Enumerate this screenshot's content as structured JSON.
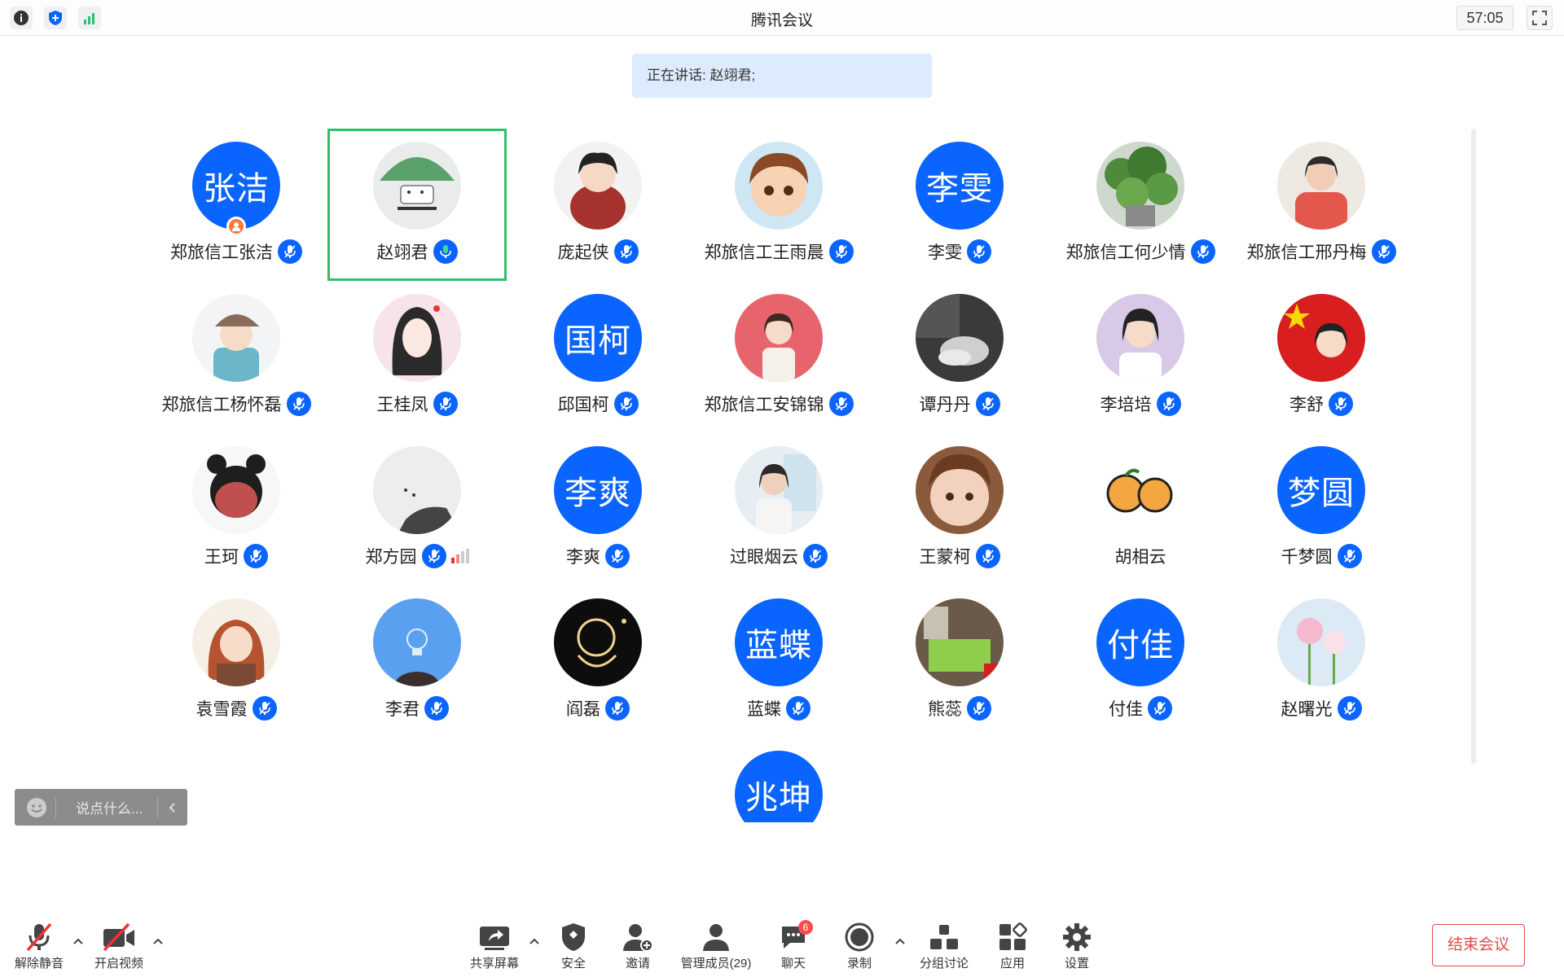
{
  "window": {
    "title": "腾讯会议",
    "timer": "57:05"
  },
  "speaking_banner": "正在讲话: 赵翊君;",
  "colors": {
    "accent": "#0a64ff",
    "active_border": "#2fbf6b",
    "end_red": "#e14b4b",
    "banner_bg": "#dcebfd"
  },
  "participants": [
    {
      "name": "郑旅信工张洁",
      "initials": "张洁",
      "host": true
    },
    {
      "name": "赵翊君",
      "avatar": "umbrella-cat",
      "active": true
    },
    {
      "name": "庞起侠",
      "avatar": "girl-red"
    },
    {
      "name": "郑旅信工王雨晨",
      "avatar": "cartoon-boy"
    },
    {
      "name": "李雯",
      "initials": "李雯"
    },
    {
      "name": "郑旅信工何少情",
      "avatar": "plant"
    },
    {
      "name": "郑旅信工邢丹梅",
      "avatar": "girl-reading"
    },
    {
      "name": "郑旅信工杨怀磊",
      "avatar": "girl-scarf"
    },
    {
      "name": "王桂凤",
      "avatar": "girl-drawing"
    },
    {
      "name": "邱国柯",
      "initials": "国柯"
    },
    {
      "name": "郑旅信工安锦锦",
      "avatar": "girl-pink"
    },
    {
      "name": "谭丹丹",
      "avatar": "bw-photo"
    },
    {
      "name": "李培培",
      "avatar": "girl-purple"
    },
    {
      "name": "李舒",
      "avatar": "flag-girl"
    },
    {
      "name": "王珂",
      "avatar": "cartoon-girl-bun"
    },
    {
      "name": "郑方园",
      "avatar": "sketch",
      "signal": true
    },
    {
      "name": "李爽",
      "initials": "李爽"
    },
    {
      "name": "过眼烟云",
      "avatar": "woman-photo"
    },
    {
      "name": "王蒙柯",
      "avatar": "child"
    },
    {
      "name": "胡相云",
      "avatar": "oranges",
      "no_mic": true
    },
    {
      "name": "千梦圆",
      "initials": "梦圆"
    },
    {
      "name": "袁雪霞",
      "avatar": "girl-hat"
    },
    {
      "name": "李君",
      "avatar": "bulb"
    },
    {
      "name": "阎磊",
      "avatar": "astronaut"
    },
    {
      "name": "蓝蝶",
      "initials": "蓝蝶"
    },
    {
      "name": "熊蕊",
      "avatar": "room"
    },
    {
      "name": "付佳",
      "initials": "付佳"
    },
    {
      "name": "赵曙光",
      "avatar": "flowers"
    },
    {
      "name": "",
      "initials": "兆坤",
      "partial": true
    }
  ],
  "chat": {
    "placeholder": "说点什么..."
  },
  "toolbar": {
    "unmute": "解除静音",
    "start_video": "开启视频",
    "share_screen": "共享屏幕",
    "security": "安全",
    "invite": "邀请",
    "members": "管理成员(29)",
    "chat": "聊天",
    "chat_badge": "6",
    "record": "录制",
    "breakout": "分组讨论",
    "apps": "应用",
    "settings": "设置",
    "end_meeting": "结束会议"
  }
}
